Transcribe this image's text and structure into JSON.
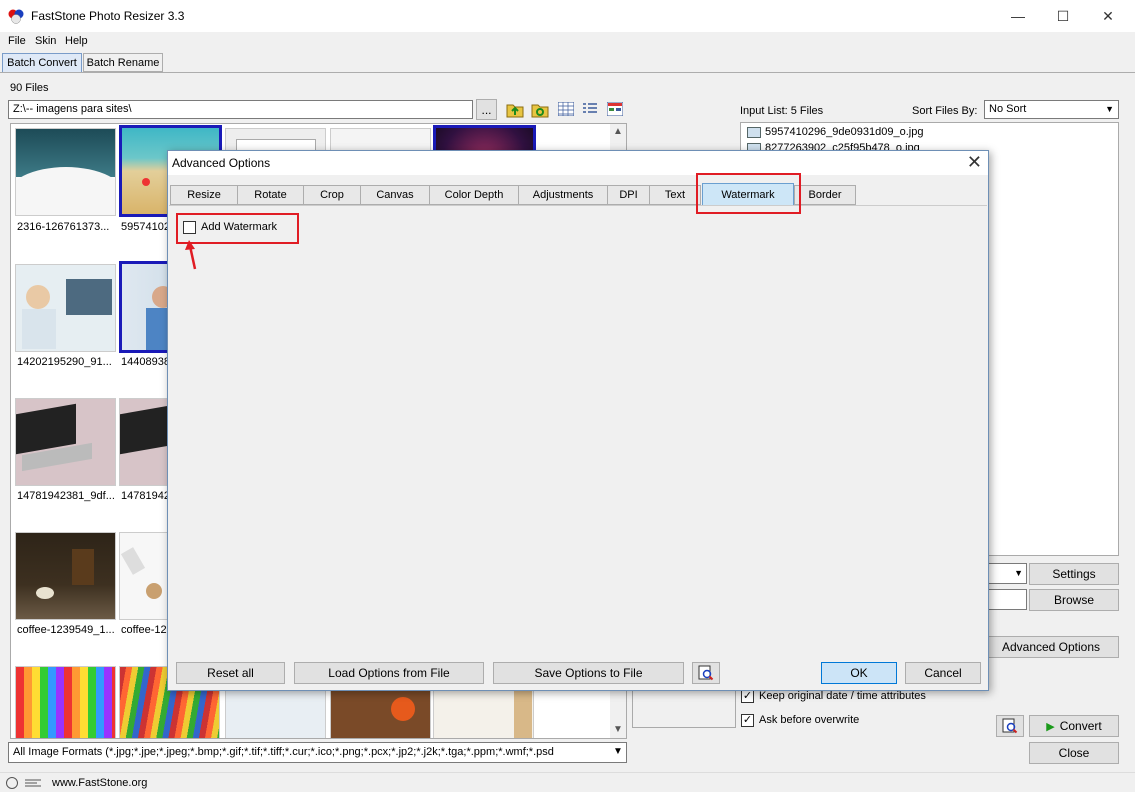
{
  "window": {
    "title": "FastStone Photo Resizer 3.3",
    "controls": {
      "minimize": "—",
      "maximize": "☐",
      "close": "✕"
    }
  },
  "menu": [
    "File",
    "Skin",
    "Help"
  ],
  "top_tabs": [
    "Batch Convert",
    "Batch Rename"
  ],
  "browser": {
    "files_count": "90 Files",
    "path": "Z:\\-- imagens para sites\\",
    "browse_label": "...",
    "format_filter": "All Image Formats (*.jpg;*.jpe;*.jpeg;*.bmp;*.gif;*.tif;*.tiff;*.cur;*.ico;*.png;*.pcx;*.jp2;*.j2k;*.tga;*.ppm;*.wmf;*.psd",
    "thumbnails": [
      {
        "label": "2316-126761373..."
      },
      {
        "label": "59574102..."
      },
      {
        "label": ""
      },
      {
        "label": ""
      },
      {
        "label": ""
      },
      {
        "label": "14202195290_91..."
      },
      {
        "label": "14408938..."
      },
      {
        "label": "14781942381_9df..."
      },
      {
        "label": "14781942..."
      },
      {
        "label": "coffee-1239549_1..."
      },
      {
        "label": "coffee-12..."
      }
    ]
  },
  "right_pane": {
    "input_list_label": "Input List:  5 Files",
    "sort_label": "Sort Files By:",
    "sort_value": "No Sort",
    "files": [
      "5957410296_9de0931d09_o.jpg",
      "8277263902_c25f95b478_o.jpg"
    ],
    "settings_label": "Settings",
    "browse_label": "Browse",
    "advanced_options_label": "Advanced Options",
    "keep_date_label": "Keep original date / time attributes",
    "ask_overwrite_label": "Ask before overwrite",
    "convert_label": "Convert",
    "close_label": "Close"
  },
  "status": {
    "website": "www.FastStone.org"
  },
  "dialog": {
    "title": "Advanced Options",
    "tabs": [
      "Resize",
      "Rotate",
      "Crop",
      "Canvas",
      "Color Depth",
      "Adjustments",
      "DPI",
      "Text",
      "Watermark",
      "Border"
    ],
    "active_tab": "Watermark",
    "add_watermark_label": "Add Watermark",
    "reset_label": "Reset all",
    "load_label": "Load Options from File",
    "save_label": "Save Options to File",
    "ok_label": "OK",
    "cancel_label": "Cancel"
  },
  "colors": {
    "highlight": "#e01c24",
    "selection": "#1a1ab8",
    "accent": "#0078d7"
  }
}
